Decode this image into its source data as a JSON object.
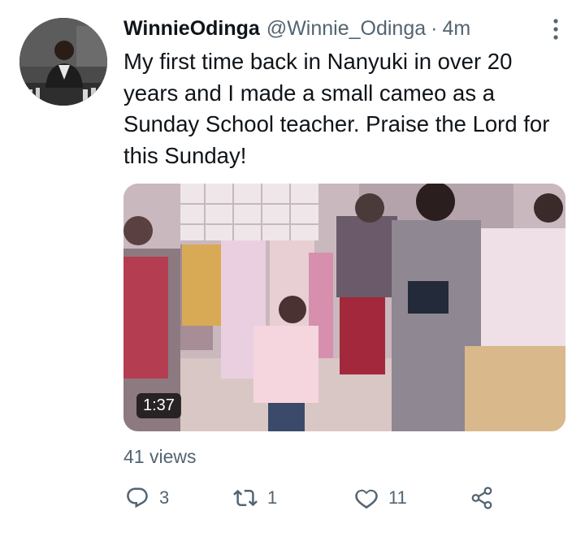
{
  "tweet": {
    "display_name": "WinnieOdinga",
    "handle": "@Winnie_Odinga",
    "separator": "·",
    "time": "4m",
    "text": "My first time back in Nanyuki in over 20 years and I made a small cameo as a Sunday School teacher. Praise the Lord for this Sunday!",
    "video_duration": "1:37",
    "views": "41 views"
  },
  "actions": {
    "reply_count": "3",
    "retweet_count": "1",
    "like_count": "11"
  },
  "icons": {
    "more": "more-vertical-icon",
    "reply": "reply-icon",
    "retweet": "retweet-icon",
    "like": "heart-icon",
    "share": "share-icon"
  },
  "colors": {
    "text": "#0f1419",
    "secondary": "#536471",
    "video_tint": "#c9b8bd"
  }
}
